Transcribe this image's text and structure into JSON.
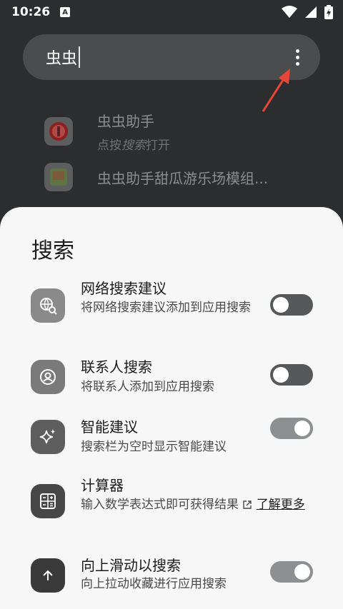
{
  "status_bar": {
    "time": "10:26",
    "notification_badge": "A"
  },
  "search": {
    "query": "虫虫"
  },
  "results": [
    {
      "title": "虫虫助手",
      "subtitle_pre": "点按",
      "subtitle_em": "搜索",
      "subtitle_post": "打开"
    },
    {
      "title": "虫虫助手甜瓜游乐场模组..."
    }
  ],
  "sheet": {
    "title": "搜索",
    "items": [
      {
        "title": "网络搜索建议",
        "subtitle": "将网络搜索建议添加到应用搜索",
        "enabled": false,
        "icon": "web-search-icon"
      },
      {
        "title": "联系人搜索",
        "subtitle": "将联系人添加到应用搜索",
        "enabled": false,
        "icon": "contact-icon"
      },
      {
        "title": "智能建议",
        "subtitle": "搜索栏为空时显示智能建议",
        "enabled": true,
        "icon": "sparkle-icon"
      },
      {
        "title": "计算器",
        "subtitle": "输入数学表达式即可获得结果",
        "link": "了解更多",
        "icon": "calculator-icon"
      },
      {
        "title": "向上滑动以搜索",
        "subtitle": "向上拉动收藏进行应用搜索",
        "enabled": true,
        "icon": "arrow-up-icon"
      }
    ]
  },
  "colors": {
    "scrim": "#2b2d2e",
    "sheet": "#f7f7f7",
    "accent_arrow": "#e8463a"
  }
}
